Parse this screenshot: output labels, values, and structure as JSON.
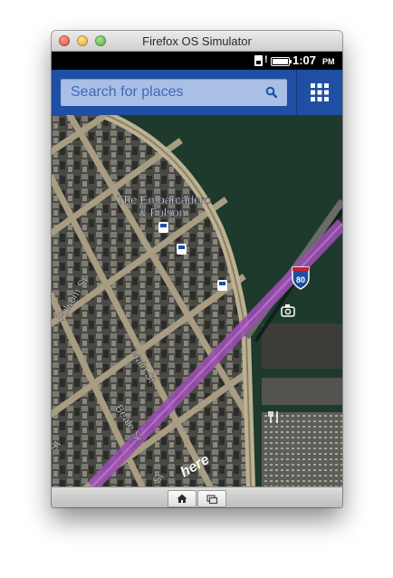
{
  "window": {
    "title": "Firefox OS Simulator"
  },
  "statusbar": {
    "time": "1:07",
    "ampm": "PM",
    "icons": [
      "sim-card-icon",
      "battery-icon"
    ]
  },
  "search": {
    "placeholder": "Search for places",
    "value": ""
  },
  "map": {
    "place_label_line1": "The Embarcadero",
    "place_label_line2": "& Folsom",
    "streets": [
      "Folsom St",
      "Main St",
      "Beale St",
      "St",
      "St"
    ],
    "highway_shield": "80",
    "watermark": "here",
    "markers": [
      "transit-icon",
      "transit-icon",
      "transit-icon",
      "camera-icon",
      "restaurant-icon"
    ]
  },
  "colors": {
    "appbar": "#1e4fa3",
    "search_bg": "#a9bfe5",
    "highway": "#9a4fb0",
    "water": "#1d3a2c"
  },
  "bottombar": {
    "buttons": [
      "home-icon",
      "windows-icon"
    ]
  }
}
